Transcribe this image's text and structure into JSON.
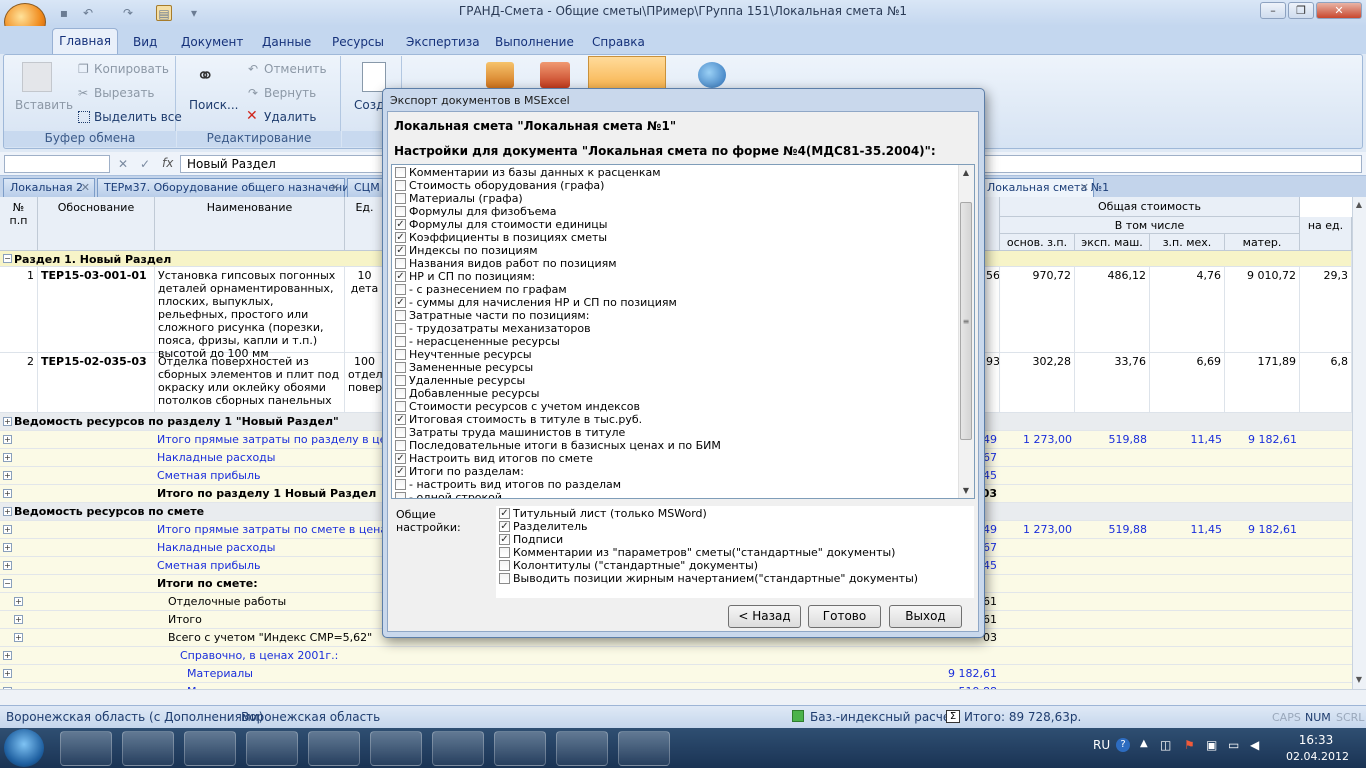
{
  "window": {
    "title": "ГРАНД-Смета - Общие сметы\\ПРимер\\ГРуппа 151\\Локальная смета №1"
  },
  "ribbon_tabs": [
    "Главная",
    "Вид",
    "Документ",
    "Данные",
    "Ресурсы",
    "Экспертиза",
    "Выполнение",
    "Справка"
  ],
  "ribbon": {
    "clipboard": {
      "paste": "Вставить",
      "copy": "Копировать",
      "cut": "Вырезать",
      "select_all": "Выделить все",
      "group": "Буфер обмена"
    },
    "editing": {
      "search": "Поиск...",
      "undo": "Отменить",
      "redo": "Вернуть",
      "delete": "Удалить",
      "group": "Редактирование"
    },
    "create": "Созд"
  },
  "formula_bar": {
    "value": "Новый Раздел"
  },
  "doc_tabs": [
    "Локальная 2",
    "ТЕРм37. Оборудование общего назначения",
    "СЦМ",
    "Локальная смета №1"
  ],
  "grid": {
    "headers": {
      "num": "№\nп.п",
      "basis": "Обоснование",
      "name": "Наименование",
      "unit": "Ед.",
      "total": "Общая стоимость",
      "incl": "В том числе",
      "zp": "основ. з.п.",
      "em": "эксп. маш.",
      "zm": "з.п. мех.",
      "mat": "матер.",
      "per": "на ед."
    },
    "section1": "Раздел 1. Новый Раздел",
    "rows": [
      {
        "n": "1",
        "code": "ТЕР15-03-001-01",
        "name": "Установка гипсовых погонных деталей орнаментированных, плоских, выпуклых, рельефных, простого или сложного рисунка (порезки, пояса, фризы, капли и т.п.) высотой до 100 мм",
        "unit": "10\nдета",
        "c1": "56",
        "zp": "970,72",
        "em": "486,12",
        "zm": "4,76",
        "mat": "9 010,72",
        "per": "29,3"
      },
      {
        "n": "2",
        "code": "ТЕР15-02-035-03",
        "name": "Отделка поверхностей из сборных элементов и плит под окраску или оклейку обоями потолков сборных панельных",
        "unit": "100\nотдели\nповерх",
        "c1": "93",
        "zp": "302,28",
        "em": "33,76",
        "zm": "6,69",
        "mat": "171,89",
        "per": "6,8"
      }
    ],
    "lines": [
      {
        "label": "Ведомость ресурсов по разделу 1 \"Новый Раздел\"",
        "kind": "section"
      },
      {
        "label": "Итого прямые затраты по разделу в ценах 2",
        "kind": "blue",
        "c1": "49",
        "zp": "1 273,00",
        "em": "519,88",
        "zm": "11,45",
        "mat": "9 182,61"
      },
      {
        "label": "Накладные расходы",
        "kind": "blue",
        "c1": "67"
      },
      {
        "label": "Сметная прибыль",
        "kind": "blue",
        "c1": "45"
      },
      {
        "label": "Итого по разделу 1 Новый Раздел",
        "kind": "bold",
        "c1": "03"
      },
      {
        "label": "Ведомость ресурсов по смете",
        "kind": "section"
      },
      {
        "label": "Итого прямые затраты по смете в ценах 200",
        "kind": "blue",
        "c1": "49",
        "zp": "1 273,00",
        "em": "519,88",
        "zm": "11,45",
        "mat": "9 182,61"
      },
      {
        "label": "Накладные расходы",
        "kind": "blue",
        "c1": "67"
      },
      {
        "label": "Сметная прибыль",
        "kind": "blue",
        "c1": "45"
      },
      {
        "label": "Итоги по смете:",
        "kind": "bold"
      },
      {
        "label": "Отделочные работы",
        "kind": "plain",
        "c1": "61"
      },
      {
        "label": "Итого",
        "kind": "plain",
        "c1": "61"
      },
      {
        "label": "Всего с учетом \"Индекс СМР=5,62\"",
        "kind": "plain",
        "c1": "03"
      },
      {
        "label": "Справочно, в ценах 2001г.:",
        "kind": "blue"
      },
      {
        "label": "Материалы",
        "kind": "blue",
        "c1": "9 182,61"
      },
      {
        "label": "М",
        "kind": "blue",
        "c1": "519,88"
      }
    ]
  },
  "dialog": {
    "title": "Экспорт документов в MSExcel",
    "heading": "Локальная смета \"Локальная смета №1\"",
    "settings_heading": "Настройки для документа \"Локальная смета по форме №4(МДС81-35.2004)\":",
    "options": [
      {
        "label": "Комментарии из базы данных к расценкам",
        "checked": false
      },
      {
        "label": "Стоимость оборудования (графа)",
        "checked": false
      },
      {
        "label": "Материалы (графа)",
        "checked": false
      },
      {
        "label": "Формулы для физобъема",
        "checked": false
      },
      {
        "label": "Формулы для стоимости единицы",
        "checked": true
      },
      {
        "label": "Коэффициенты в позициях сметы",
        "checked": true
      },
      {
        "label": "Индексы по позициям",
        "checked": true
      },
      {
        "label": "Названия видов работ по позициям",
        "checked": false
      },
      {
        "label": "НР и СП по позициям:",
        "checked": true
      },
      {
        "label": "- с разнесением по графам",
        "checked": false
      },
      {
        "label": "- суммы для начисления НР и СП по позициям",
        "checked": true
      },
      {
        "label": "Затратные части по позициям:",
        "checked": false
      },
      {
        "label": "- трудозатраты механизаторов",
        "checked": false
      },
      {
        "label": "- нерасцененные ресурсы",
        "checked": false
      },
      {
        "label": "Неучтенные ресурсы",
        "checked": false
      },
      {
        "label": "Замененные ресурсы",
        "checked": false
      },
      {
        "label": "Удаленные ресурсы",
        "checked": false
      },
      {
        "label": "Добавленные ресурсы",
        "checked": false
      },
      {
        "label": "Стоимости ресурсов с учетом индексов",
        "checked": false
      },
      {
        "label": "Итоговая стоимость в титуле в тыс.руб.",
        "checked": true
      },
      {
        "label": "Затраты труда машинистов в титуле",
        "checked": false
      },
      {
        "label": "Последовательные итоги в базисных ценах и по БИМ",
        "checked": false
      },
      {
        "label": "Настроить вид итогов по смете",
        "checked": true
      },
      {
        "label": "Итоги по разделам:",
        "checked": true
      },
      {
        "label": "- настроить вид итогов по разделам",
        "checked": false
      },
      {
        "label": "- одной строкой",
        "checked": false
      }
    ],
    "general_label": "Общие\nнастройки:",
    "general": [
      {
        "label": "Титульный лист (только MSWord)",
        "checked": true
      },
      {
        "label": "Разделитель",
        "checked": true
      },
      {
        "label": "Подписи",
        "checked": true
      },
      {
        "label": "Комментарии из \"параметров\" сметы(\"стандартные\" документы)",
        "checked": false
      },
      {
        "label": "Колонтитулы (\"стандартные\" документы)",
        "checked": false
      },
      {
        "label": "Выводить позиции жирным начертанием(\"стандартные\" документы)",
        "checked": false
      }
    ],
    "buttons": {
      "back": "< Назад",
      "done": "Готово",
      "exit": "Выход"
    }
  },
  "statusbar": {
    "region1": "Воронежская область (с Дополнениями)",
    "region2": "Воронежская область",
    "calc": "Баз.-индексный расчет",
    "total": "Итого: 89 728,63р.",
    "caps": "CAPS",
    "num": "NUM",
    "scrl": "SCRL"
  },
  "taskbar": {
    "lang": "RU",
    "time": "16:33",
    "date": "02.04.2012"
  },
  "check_mark": "✓",
  "colors": {
    "accent": "#15317a",
    "blue_text": "#1a2edb",
    "section_bg": "#f7f4c8"
  }
}
